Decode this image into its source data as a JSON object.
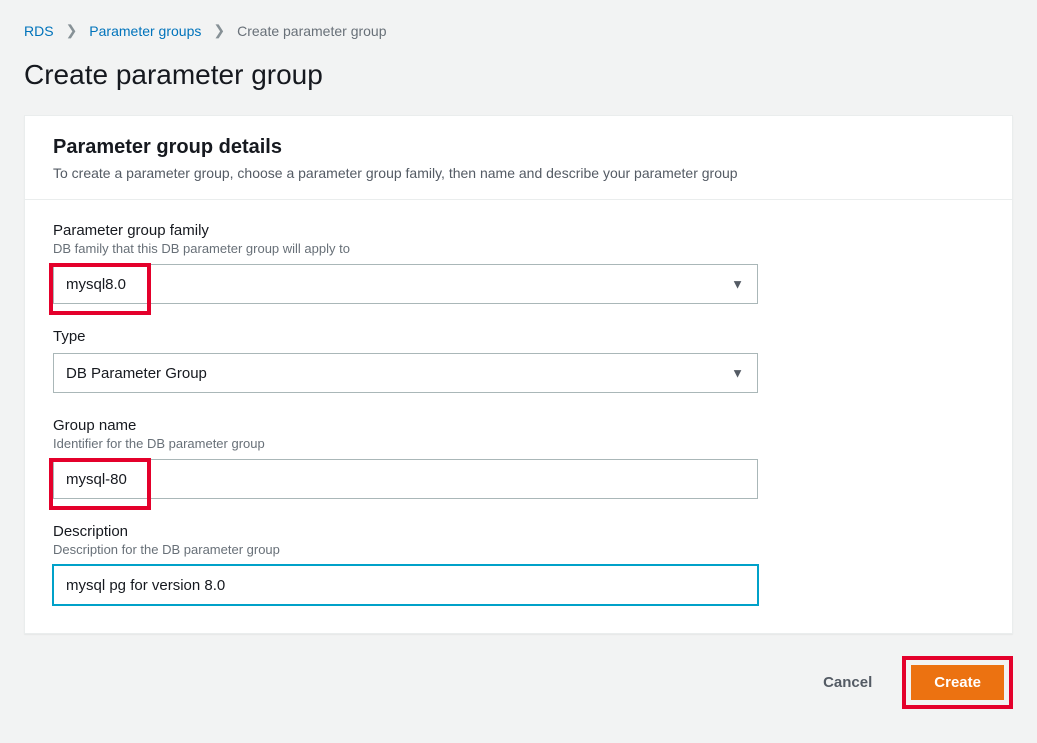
{
  "breadcrumb": {
    "root": "RDS",
    "groups": "Parameter groups",
    "current": "Create parameter group"
  },
  "page_title": "Create parameter group",
  "panel": {
    "title": "Parameter group details",
    "subtitle": "To create a parameter group, choose a parameter group family, then name and describe your parameter group"
  },
  "fields": {
    "family": {
      "label": "Parameter group family",
      "hint": "DB family that this DB parameter group will apply to",
      "value": "mysql8.0"
    },
    "type": {
      "label": "Type",
      "value": "DB Parameter Group"
    },
    "group_name": {
      "label": "Group name",
      "hint": "Identifier for the DB parameter group",
      "value": "mysql-80"
    },
    "description": {
      "label": "Description",
      "hint": "Description for the DB parameter group",
      "value": "mysql pg for version 8.0"
    }
  },
  "buttons": {
    "cancel": "Cancel",
    "create": "Create"
  }
}
